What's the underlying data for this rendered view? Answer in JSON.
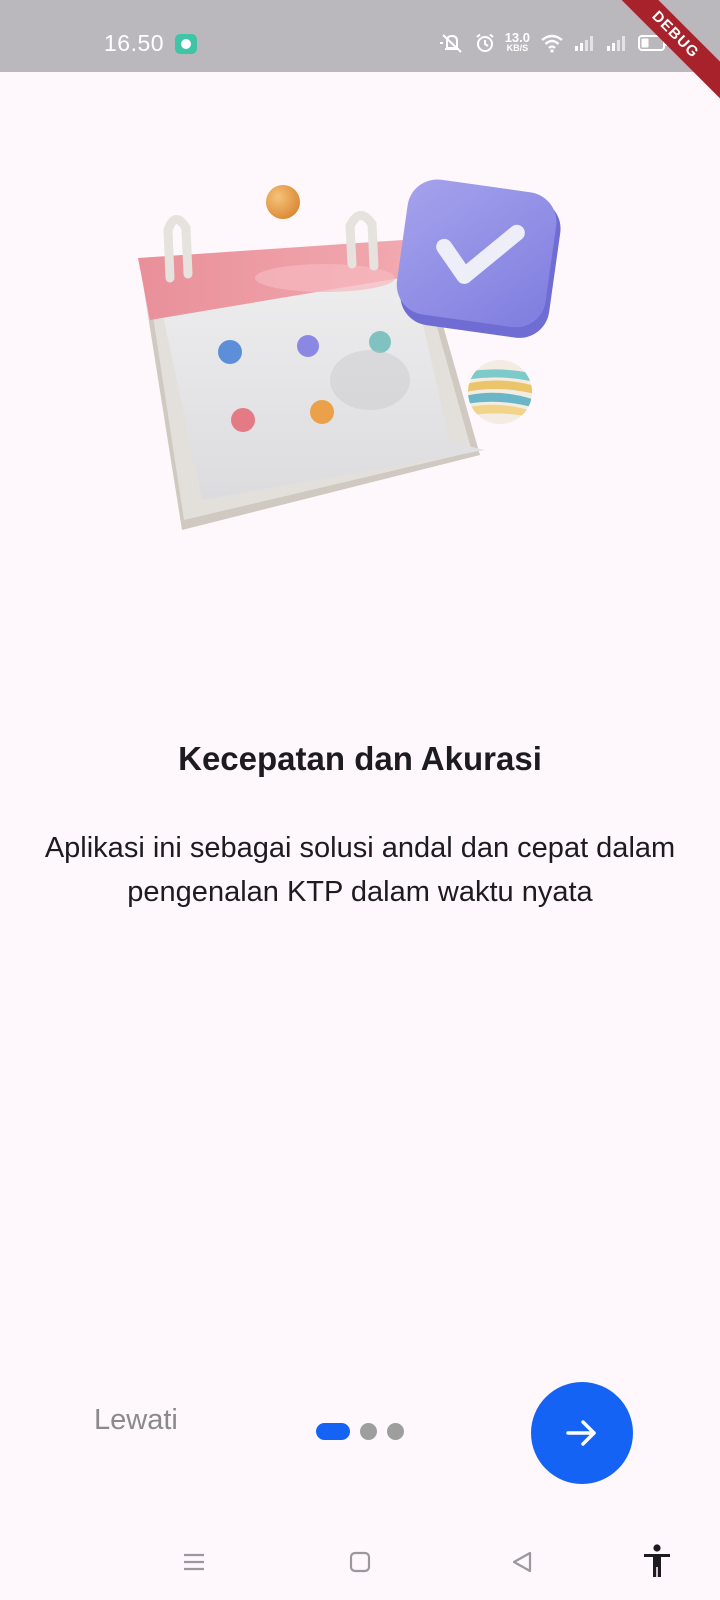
{
  "status_bar": {
    "time": "16.50",
    "net_speed_value": "13.0",
    "net_speed_unit": "KB/S",
    "icons": [
      "notification-app-icon",
      "mute-icon",
      "alarm-icon",
      "wifi-icon",
      "signal-icon",
      "signal-icon",
      "battery-icon"
    ]
  },
  "debug_banner": "DEBUG",
  "onboarding": {
    "title": "Kecepatan dan Akurasi",
    "description": "Aplikasi ini sebagai solusi andal dan cepat dalam pengenalan KTP dalam waktu nyata",
    "illustration_icon": "calendar-check-illustration"
  },
  "controls": {
    "skip_label": "Lewati",
    "page_count": 3,
    "current_page": 1,
    "next_icon": "arrow-right-icon"
  },
  "colors": {
    "accent": "#1563f5",
    "background": "#fef7fb",
    "status_bar": "#bab8bd",
    "debug": "#a8222b"
  },
  "nav_bar": {
    "icons": [
      "menu-icon",
      "home-icon",
      "back-icon",
      "accessibility-icon"
    ]
  }
}
